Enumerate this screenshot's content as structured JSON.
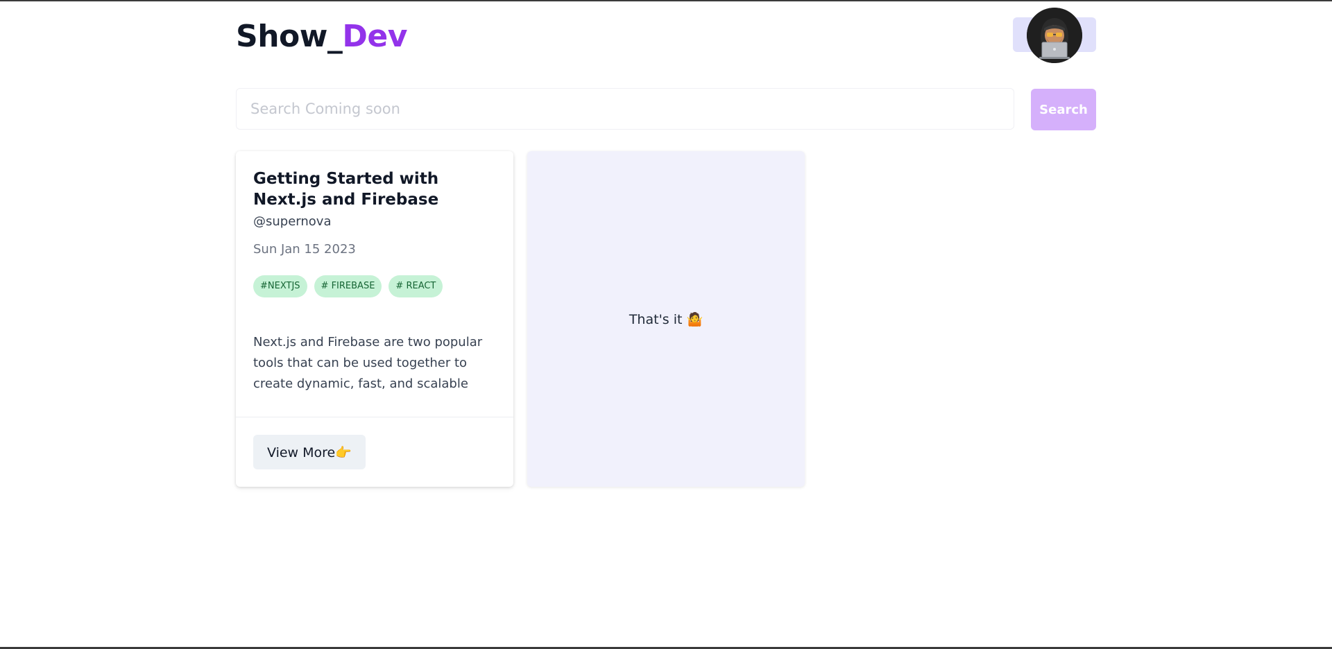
{
  "header": {
    "logo_main": "Show_",
    "logo_accent": "Dev",
    "avatar_icon": "hacker-laptop-avatar"
  },
  "search": {
    "placeholder": "Search Coming soon",
    "value": "",
    "button_label": "Search"
  },
  "posts": [
    {
      "title": "Getting Started with Next.js and Firebase",
      "author": "@supernova",
      "date": "Sun Jan 15 2023",
      "tags": [
        "#NEXTJS",
        "# FIREBASE",
        "# REACT"
      ],
      "excerpt": "Next.js and Firebase are two popular tools that can be used together to create dynamic, fast, and scalable we...",
      "view_more_label": "View More👉"
    }
  ],
  "end_card": {
    "text": "That's it 🤷"
  },
  "colors": {
    "accent": "#9333ea",
    "search_button": "#d5b0fb",
    "tag_bg": "#c6f2d6",
    "end_card_bg": "#f1f1fc"
  }
}
